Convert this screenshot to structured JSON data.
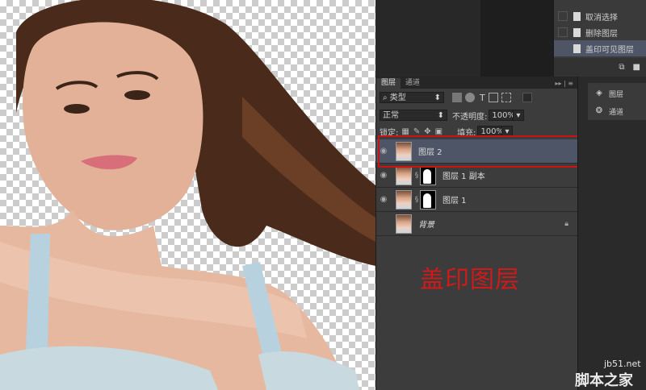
{
  "history": {
    "items": [
      {
        "label": "取消选择",
        "selected": false
      },
      {
        "label": "删除图层",
        "selected": false
      },
      {
        "label": "盖印可见图层",
        "selected": true
      }
    ]
  },
  "layers_panel": {
    "tabs": [
      "图层",
      "通道"
    ],
    "filter_label": "类型",
    "blend_mode": "正常",
    "opacity_label": "不透明度:",
    "opacity_value": "100%",
    "lock_label": "锁定:",
    "fill_label": "填充:",
    "fill_value": "100%",
    "layers": [
      {
        "name": "图层 2",
        "selected": true,
        "visible": true,
        "has_mask": false,
        "locked": false
      },
      {
        "name": "图层 1 副本",
        "selected": false,
        "visible": true,
        "has_mask": true,
        "locked": false
      },
      {
        "name": "图层 1",
        "selected": false,
        "visible": true,
        "has_mask": true,
        "locked": false
      },
      {
        "name": "背景",
        "selected": false,
        "visible": false,
        "has_mask": false,
        "locked": true
      }
    ]
  },
  "annotation": "盖印图层",
  "right_panel": {
    "items": [
      {
        "label": "图层",
        "icon": "layers-icon"
      },
      {
        "label": "通道",
        "icon": "channels-icon"
      }
    ]
  },
  "watermark": {
    "url": "jb51.net",
    "name": "脚本之家"
  },
  "colors": {
    "highlight_box": "#cc1111",
    "annotation": "#d01a1a",
    "selected_row": "#4d5566"
  }
}
